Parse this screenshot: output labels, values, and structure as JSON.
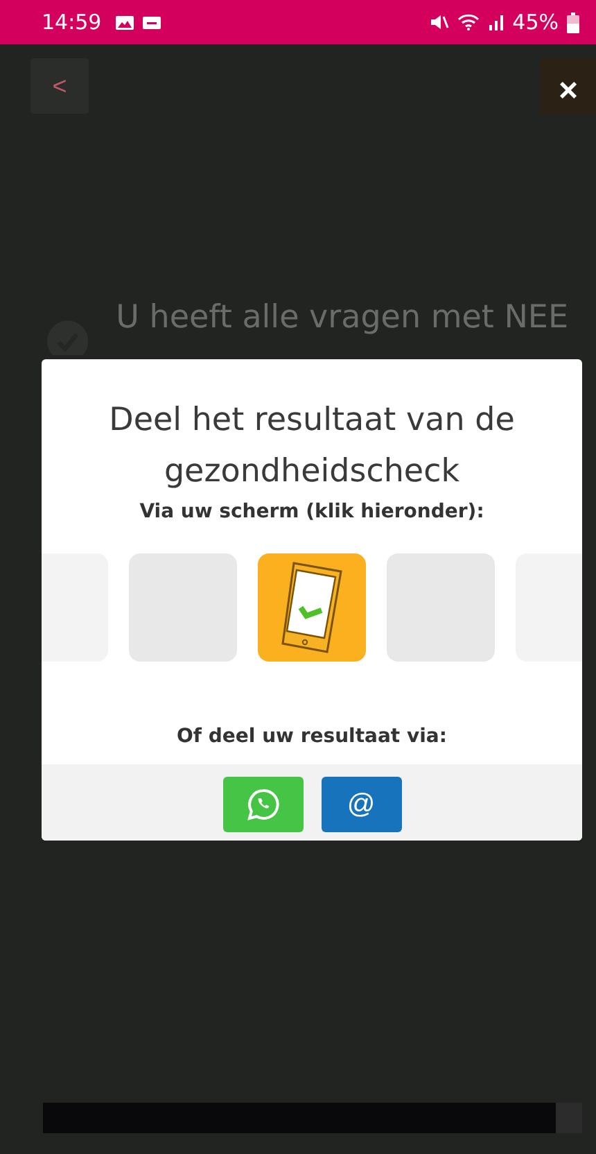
{
  "status_bar": {
    "time": "14:59",
    "battery": "45%"
  },
  "background": {
    "back_button": "<",
    "heading": "U heeft alle vragen met NEE"
  },
  "close_button": "×",
  "dialog": {
    "title": "Deel het resultaat van de gezondheidscheck",
    "subtitle": "Via uw scherm (klik hieronder):",
    "tiles": [
      {
        "selected": false
      },
      {
        "selected": false
      },
      {
        "selected": true
      },
      {
        "selected": false
      },
      {
        "selected": false
      }
    ],
    "share_label": "Of deel uw resultaat via:",
    "share_buttons": [
      {
        "kind": "whatsapp"
      },
      {
        "kind": "email",
        "label": "@"
      }
    ]
  }
}
